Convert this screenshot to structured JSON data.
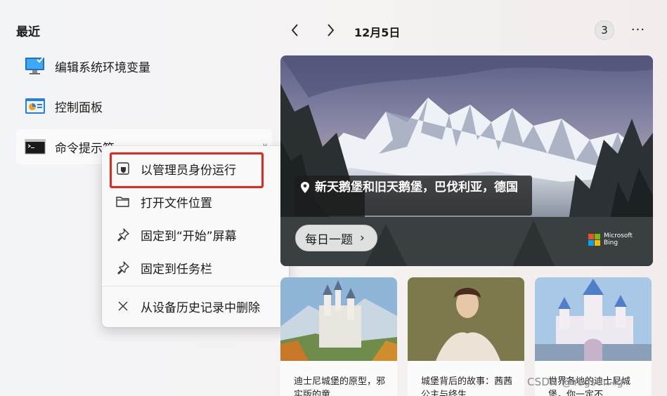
{
  "recent": {
    "title": "最近",
    "items": [
      {
        "label": "编辑系统环境变量",
        "icon": "system-environment-icon"
      },
      {
        "label": "控制面板",
        "icon": "control-panel-icon"
      },
      {
        "label": "命令提示符",
        "icon": "command-prompt-icon"
      }
    ]
  },
  "context_menu": {
    "items": [
      {
        "label": "以管理员身份运行",
        "icon": "shield-icon"
      },
      {
        "label": "打开文件位置",
        "icon": "folder-icon"
      },
      {
        "label": "固定到“开始”屏幕",
        "icon": "pin-icon"
      },
      {
        "label": "固定到任务栏",
        "icon": "pin-icon"
      },
      {
        "label": "从设备历史记录中删除",
        "icon": "close-icon"
      }
    ]
  },
  "widget": {
    "date": "12月5日",
    "badge": "3",
    "more": "···",
    "hero_caption": "新天鹅堡和旧天鹅堡，巴伐利亚，德国",
    "daily_quiz": "每日一题",
    "brand_line1": "Microsoft",
    "brand_line2": "Bing",
    "cards": [
      {
        "text": "迪士尼城堡的原型，邪实版的童"
      },
      {
        "text": "城堡背后的故事：茜茜公主与终生"
      },
      {
        "text": "世界各地的迪士尼城堡，你一定不"
      }
    ]
  },
  "watermark": "CSDN @Yogson-lg",
  "colors": {
    "highlight_box": "#e0281f",
    "ms_red": "#f25022",
    "ms_green": "#7fba00",
    "ms_blue": "#00a4ef",
    "ms_yellow": "#ffb900"
  }
}
